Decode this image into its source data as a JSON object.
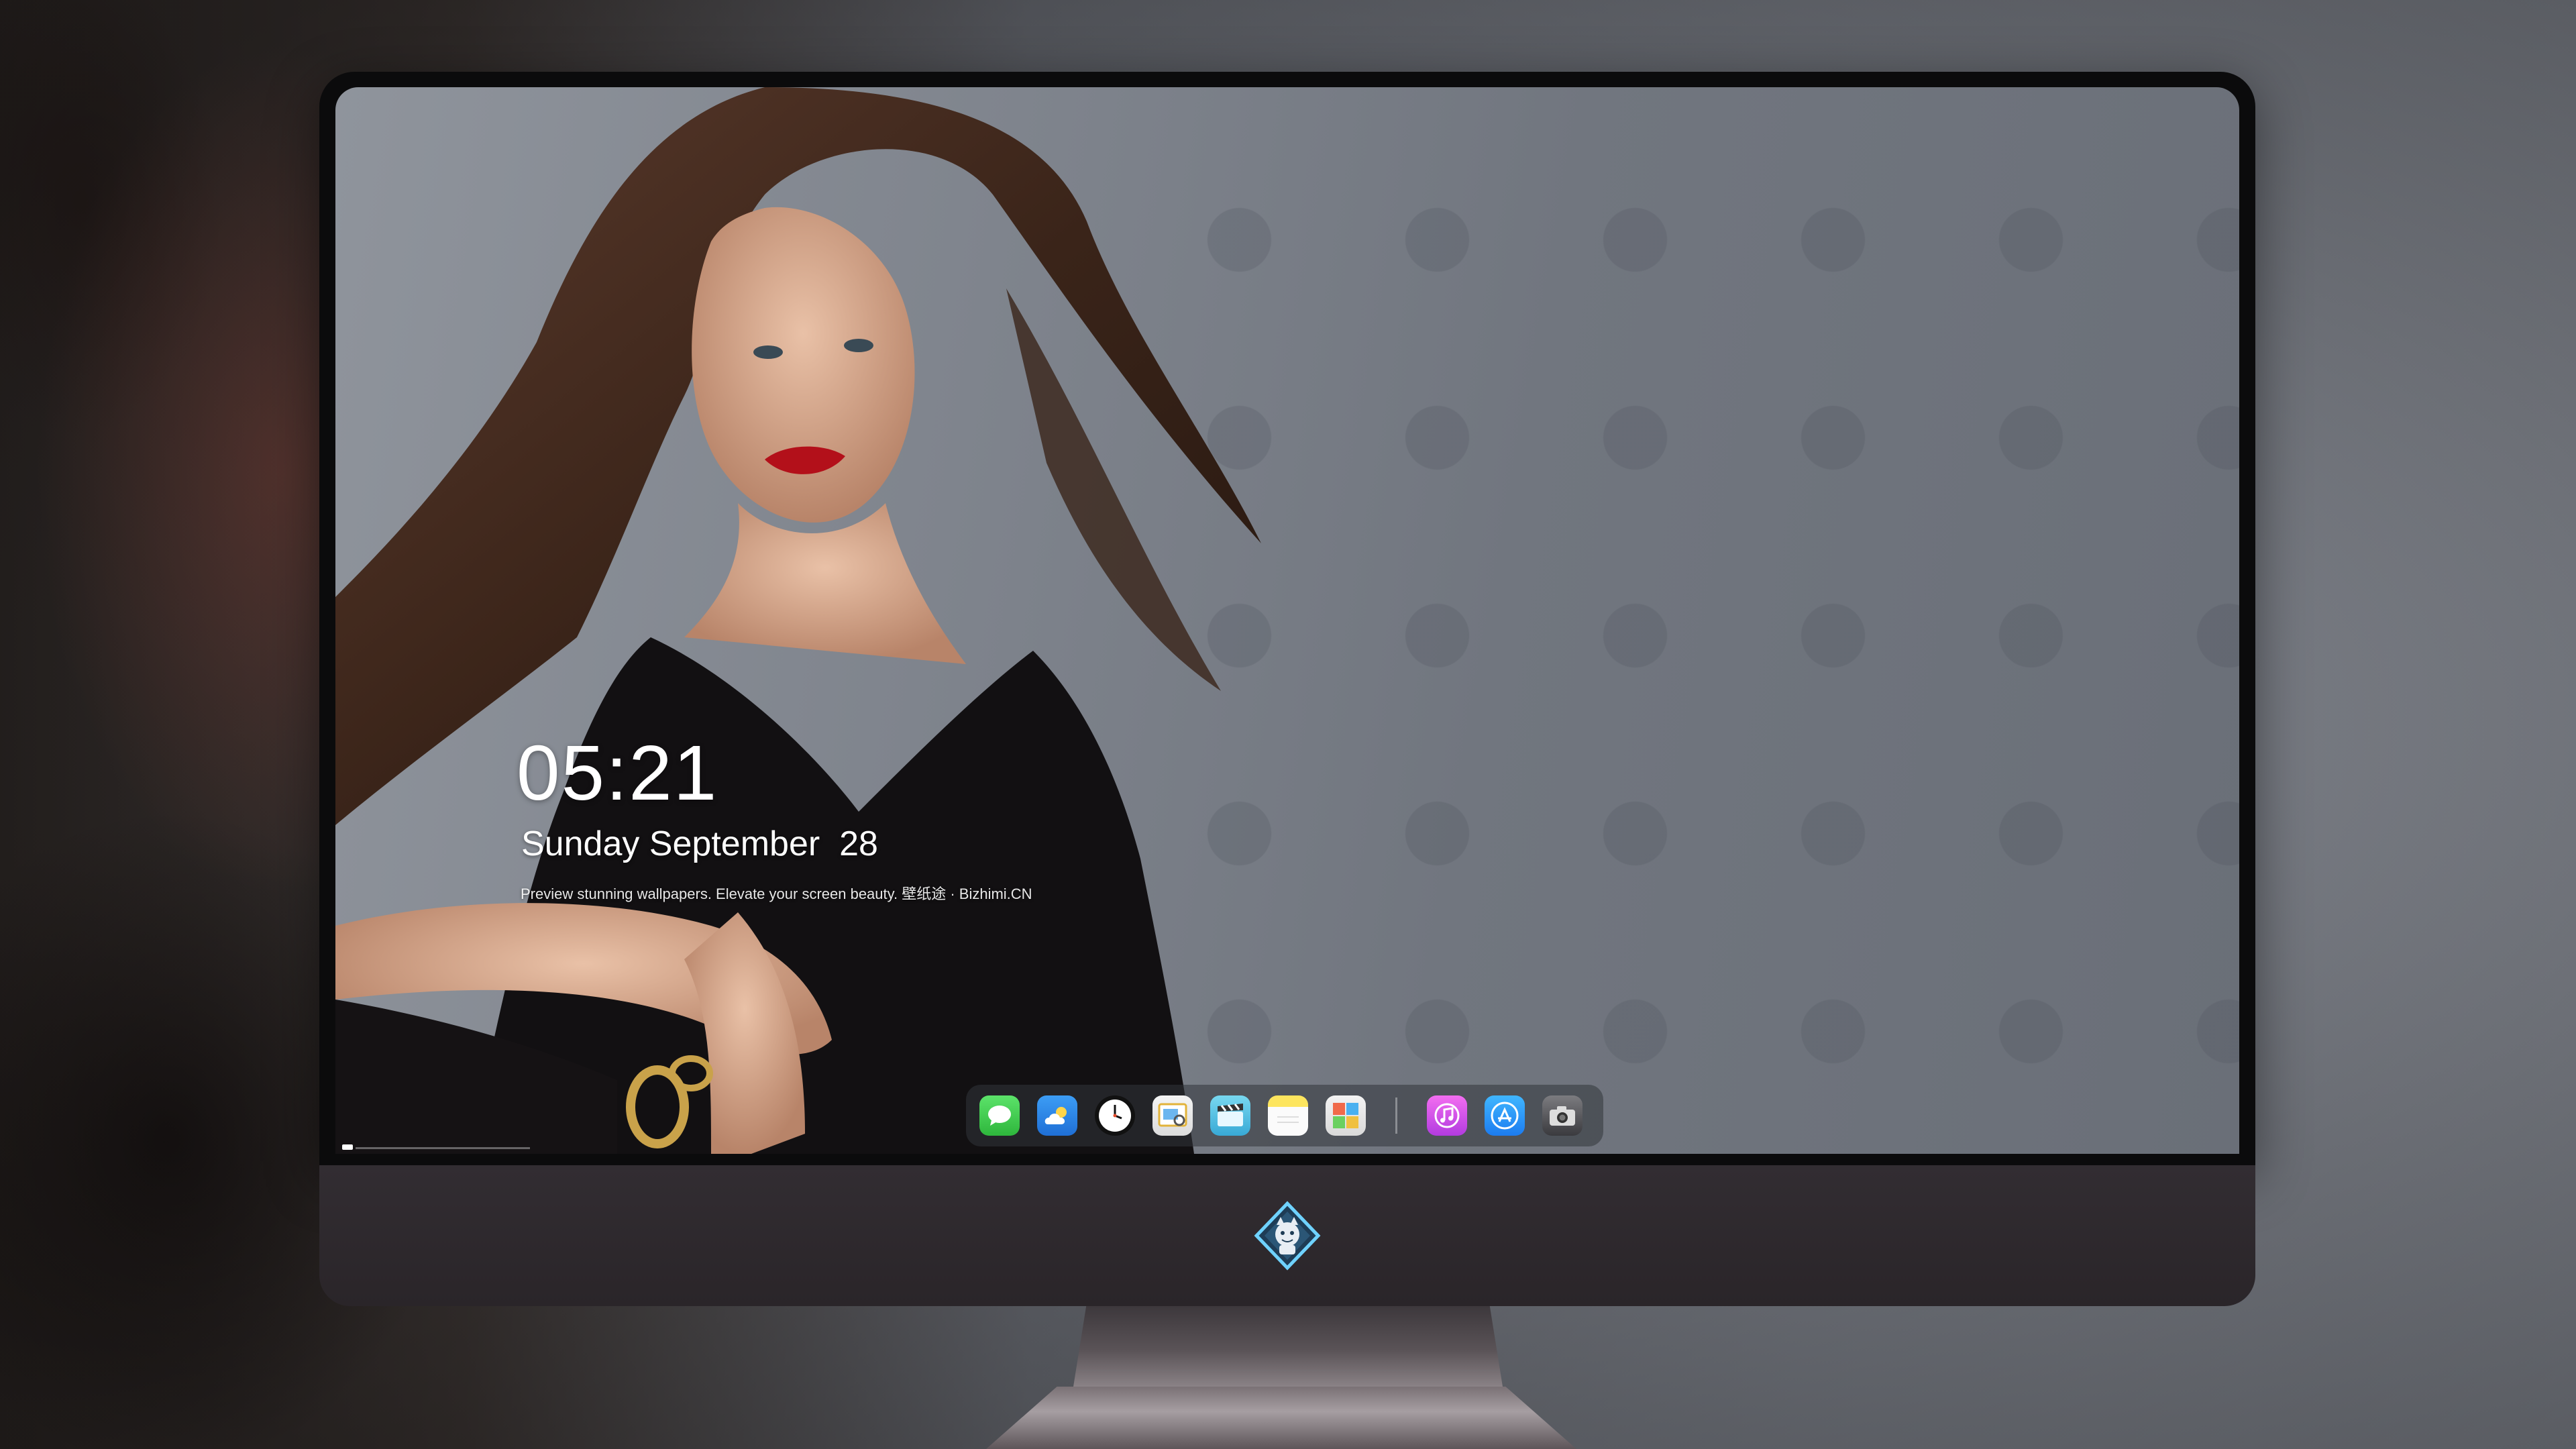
{
  "lockscreen": {
    "time": "05:21",
    "date": "Sunday September  28",
    "tagline": "Preview stunning wallpapers. Elevate your screen beauty. 壁纸途 · Bizhimi.CN"
  },
  "dock": {
    "items": [
      {
        "name": "messages-icon",
        "color": "#34c759"
      },
      {
        "name": "weather-icon",
        "color": "#2d8cf0"
      },
      {
        "name": "clock-icon",
        "color": "#111111"
      },
      {
        "name": "preview-icon",
        "color": "#f0f0f0"
      },
      {
        "name": "clips-icon",
        "color": "#5cc8ec"
      },
      {
        "name": "notes-icon",
        "color": "#fde55e"
      },
      {
        "name": "photos-icon",
        "color": "#eaeaea"
      },
      {
        "name": "music-icon",
        "color": "#e05ef0"
      },
      {
        "name": "app-store-icon",
        "color": "#1e88f5"
      },
      {
        "name": "camera-icon",
        "color": "#5a5a5e"
      }
    ]
  },
  "monitor": {
    "chin_logo": "mascot-logo-icon"
  }
}
